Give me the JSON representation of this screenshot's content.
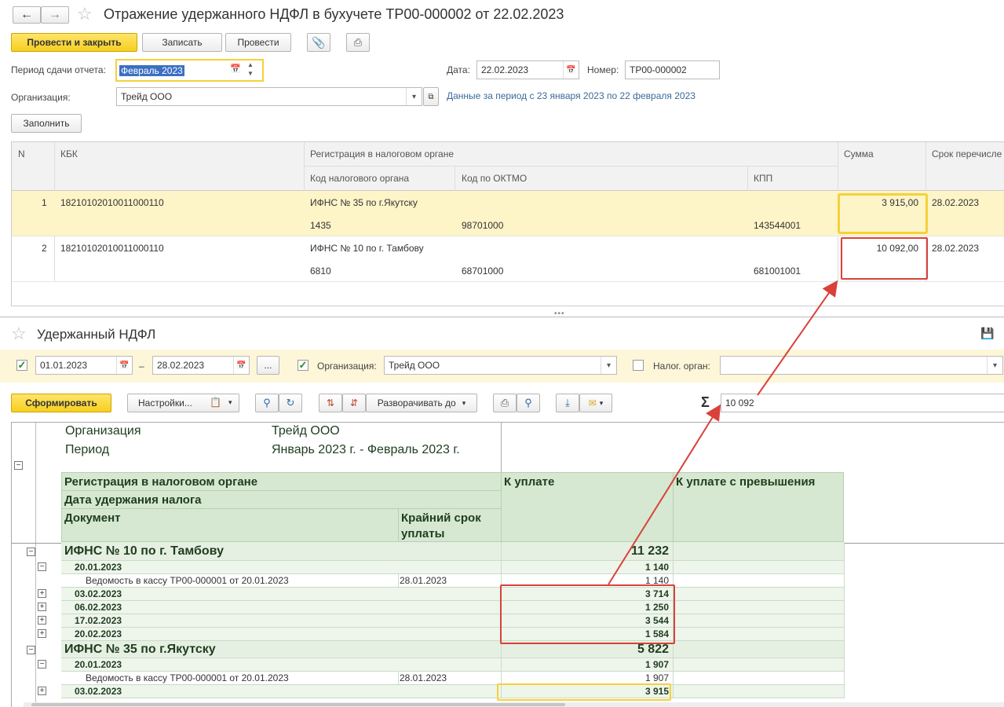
{
  "window": {
    "title": "Отражение удержанного НДФЛ в бухучете ТР00-000002 от 22.02.2023"
  },
  "toolbar": {
    "post_close": "Провести и закрыть",
    "save": "Записать",
    "post": "Провести"
  },
  "form": {
    "period_label": "Период сдачи отчета:",
    "period_value": "Февраль 2023",
    "date_label": "Дата:",
    "date_value": "22.02.2023",
    "number_label": "Номер:",
    "number_value": "ТР00-000002",
    "org_label": "Организация:",
    "org_value": "Трейд ООО",
    "period_info": "Данные за период с 23 января 2023 по 22 февраля 2023",
    "fill_button": "Заполнить"
  },
  "table": {
    "headers": {
      "n": "N",
      "kbk": "КБК",
      "reg": "Регистрация в налоговом органе",
      "tax_code": "Код налогового органа",
      "oktmo": "Код по ОКТМО",
      "kpp": "КПП",
      "sum": "Сумма",
      "deadline": "Срок перечисле"
    },
    "rows": [
      {
        "n": "1",
        "kbk": "18210102010011000110",
        "reg": "ИФНС № 35 по г.Якутску",
        "tax_code": "1435",
        "oktmo": "98701000",
        "kpp": "143544001",
        "sum": "3 915,00",
        "deadline": "28.02.2023"
      },
      {
        "n": "2",
        "kbk": "18210102010011000110",
        "reg": "ИФНС № 10 по г. Тамбову",
        "tax_code": "6810",
        "oktmo": "68701000",
        "kpp": "681001001",
        "sum": "10 092,00",
        "deadline": "28.02.2023"
      }
    ]
  },
  "report": {
    "title": "Удержанный НДФЛ",
    "date_from": "01.01.2023",
    "date_sep": "–",
    "date_to": "28.02.2023",
    "dots": "...",
    "org_label": "Организация:",
    "org_value": "Трейд ООО",
    "tax_label": "Налог. орган:",
    "tax_value": "",
    "generate": "Сформировать",
    "settings": "Настройки...",
    "expand": "Разворачивать до",
    "sum_value": "10 092",
    "hdr_org_label": "Организация",
    "hdr_org_value": "Трейд ООО",
    "hdr_period_label": "Период",
    "hdr_period_value": "Январь 2023 г. - Февраль 2023 г.",
    "col_reg": "Регистрация в налоговом органе",
    "col_date": "Дата удержания налога",
    "col_doc": "Документ",
    "col_deadline1": "Крайний срок",
    "col_deadline2": "уплаты",
    "col_pay": "К уплате",
    "col_over": "К уплате с превышения",
    "groups": [
      {
        "name": "ИФНС № 10 по г. Тамбову",
        "total": "11 232",
        "rows": [
          {
            "date": "20.01.2023",
            "amount": "1 140",
            "expanded": true,
            "doc": "Ведомость в кассу ТР00-000001 от 20.01.2023",
            "deadline": "28.01.2023",
            "doc_amount": "1 140"
          },
          {
            "date": "03.02.2023",
            "amount": "3 714"
          },
          {
            "date": "06.02.2023",
            "amount": "1 250"
          },
          {
            "date": "17.02.2023",
            "amount": "3 544"
          },
          {
            "date": "20.02.2023",
            "amount": "1 584"
          }
        ]
      },
      {
        "name": "ИФНС № 35 по г.Якутску",
        "total": "5 822",
        "rows": [
          {
            "date": "20.01.2023",
            "amount": "1 907",
            "expanded": true,
            "doc": "Ведомость в кассу ТР00-000001 от 20.01.2023",
            "deadline": "28.01.2023",
            "doc_amount": "1 907"
          },
          {
            "date": "03.02.2023",
            "amount": "3 915"
          }
        ]
      }
    ]
  },
  "colors": {
    "accent_yellow": "#f5d13a",
    "annotation_red": "#d9413a",
    "report_green": "#d6e8d1",
    "selected_row": "#fdf4c8"
  }
}
